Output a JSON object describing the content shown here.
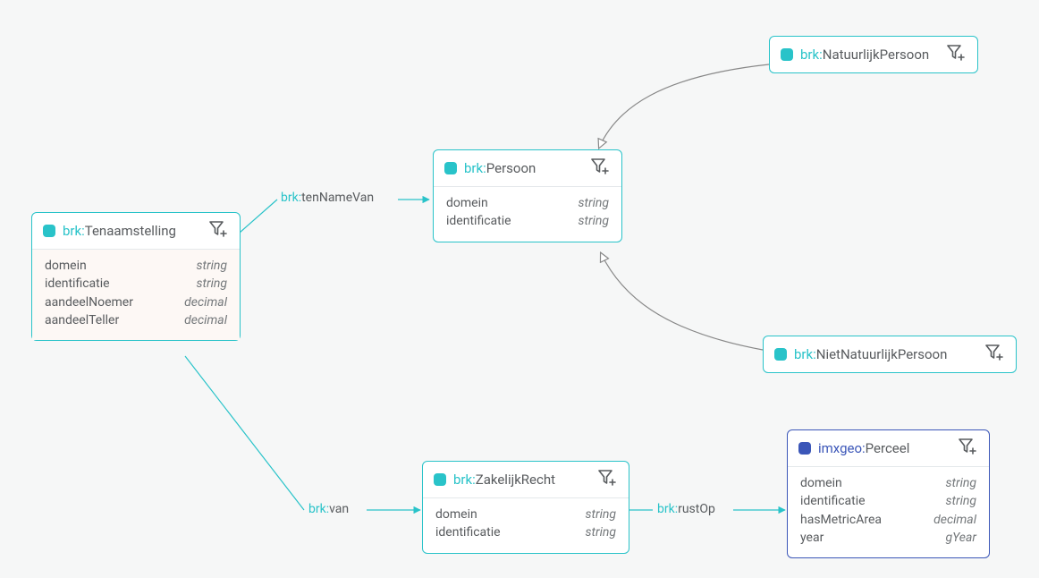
{
  "nodes": {
    "tenaamstelling": {
      "prefix": "brk:",
      "name": "Tenaamstelling",
      "attrs": [
        {
          "name": "domein",
          "type": "string"
        },
        {
          "name": "identificatie",
          "type": "string"
        },
        {
          "name": "aandeelNoemer",
          "type": "decimal"
        },
        {
          "name": "aandeelTeller",
          "type": "decimal"
        }
      ]
    },
    "persoon": {
      "prefix": "brk:",
      "name": "Persoon",
      "attrs": [
        {
          "name": "domein",
          "type": "string"
        },
        {
          "name": "identificatie",
          "type": "string"
        }
      ]
    },
    "natuurlijkPersoon": {
      "prefix": "brk:",
      "name": "NatuurlijkPersoon",
      "attrs": []
    },
    "nietNatuurlijkPersoon": {
      "prefix": "brk:",
      "name": "NietNatuurlijkPersoon",
      "attrs": []
    },
    "zakelijkRecht": {
      "prefix": "brk:",
      "name": "ZakelijkRecht",
      "attrs": [
        {
          "name": "domein",
          "type": "string"
        },
        {
          "name": "identificatie",
          "type": "string"
        }
      ]
    },
    "perceel": {
      "prefix": "imxgeo:",
      "name": "Perceel",
      "attrs": [
        {
          "name": "domein",
          "type": "string"
        },
        {
          "name": "identificatie",
          "type": "string"
        },
        {
          "name": "hasMetricArea",
          "type": "decimal"
        },
        {
          "name": "year",
          "type": "gYear"
        }
      ]
    }
  },
  "edges": {
    "tenNameVan": {
      "prefix": "brk:",
      "name": "tenNameVan"
    },
    "van": {
      "prefix": "brk:",
      "name": "van"
    },
    "rustOp": {
      "prefix": "brk:",
      "name": "rustOp"
    }
  }
}
